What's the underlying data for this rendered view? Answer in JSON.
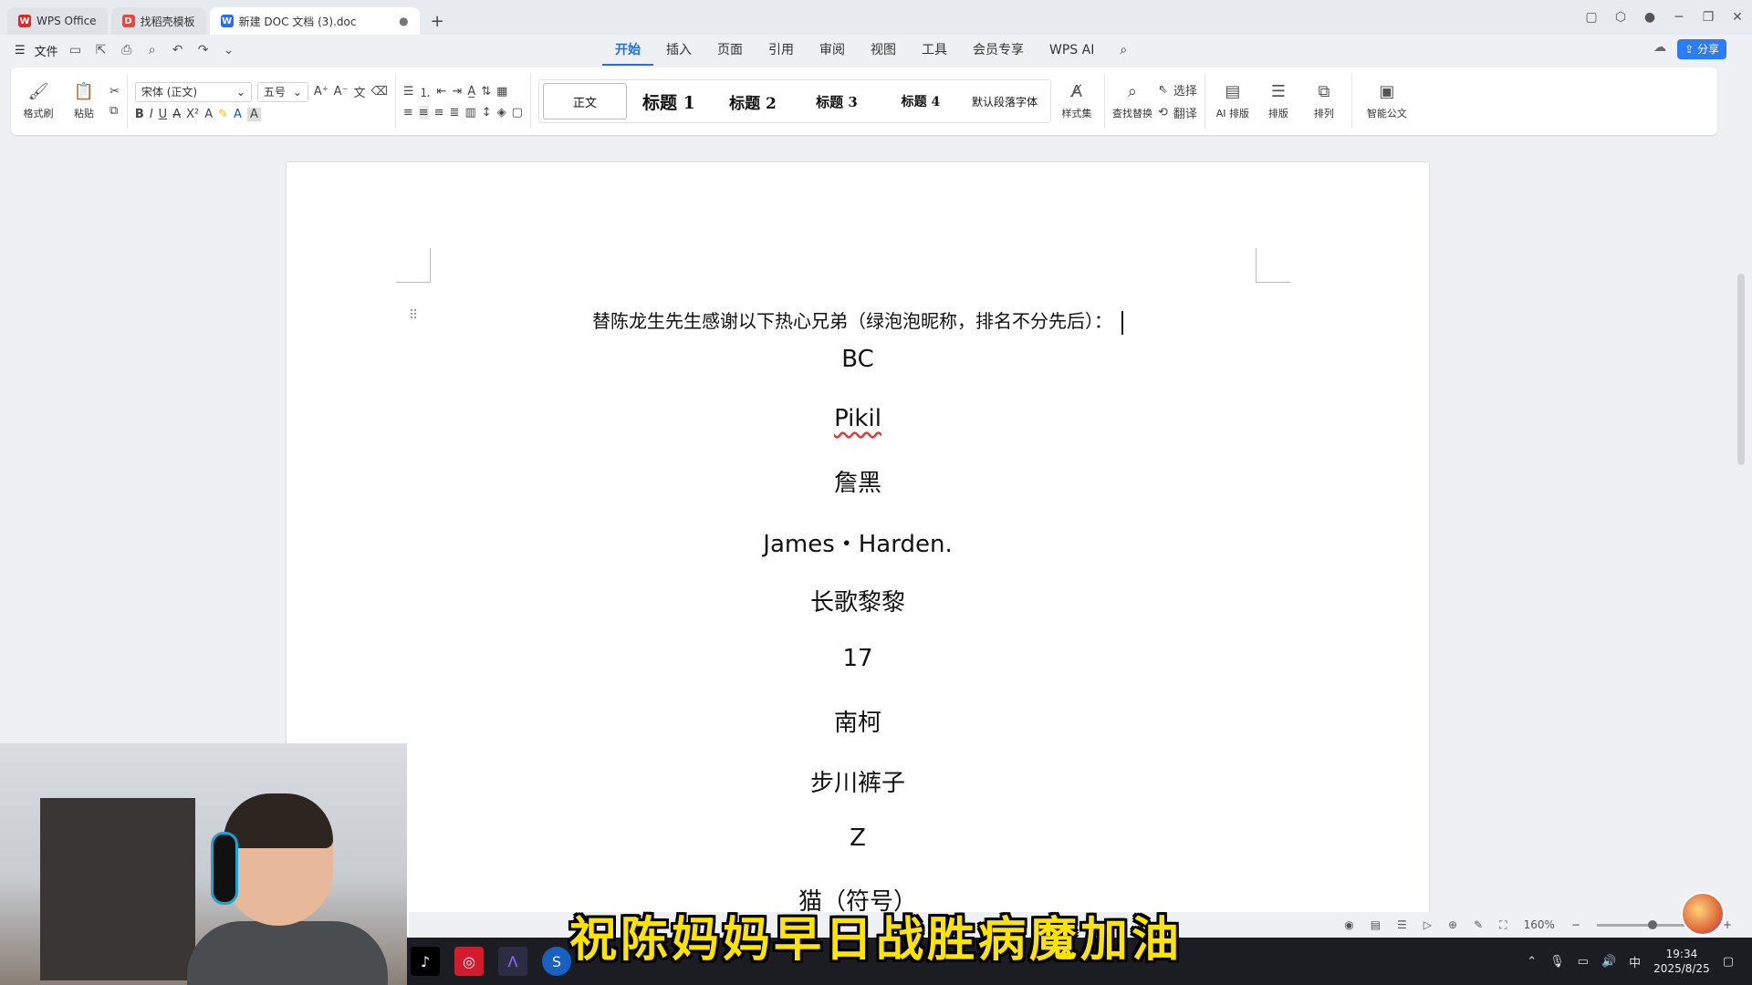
{
  "tabs": [
    {
      "label": "WPS Office",
      "color": "#d9292b",
      "glyph": "W"
    },
    {
      "label": "找稻壳模板",
      "color": "#e34a3d",
      "glyph": "D"
    },
    {
      "label": "新建 DOC 文档 (3).doc",
      "color": "#2b6de8",
      "glyph": "W"
    }
  ],
  "menubar": {
    "file": "文件",
    "items": [
      "开始",
      "插入",
      "页面",
      "引用",
      "审阅",
      "视图",
      "工具",
      "会员专享",
      "WPS AI"
    ],
    "selected": "开始",
    "share": "分享"
  },
  "ribbon": {
    "format_painter": "格式刷",
    "paste": "粘贴",
    "font_name": "宋体 (正文)",
    "font_size": "五号",
    "styles": [
      "正文",
      "标题 1",
      "标题 2",
      "标题 3",
      "标题 4",
      "默认段落字体"
    ],
    "style_set": "样式集",
    "find_replace": "查找替换",
    "select": "选择",
    "translate": "翻译",
    "ai_layout": "AI 排版",
    "layout": "排版",
    "arrange": "排列",
    "smart_doc": "智能公文"
  },
  "document": {
    "intro": "替陈龙生先生感谢以下热心兄弟（绿泡泡昵称，排名不分先后）：",
    "names": [
      "BC",
      "Pikil",
      "詹黑",
      "James・Harden.",
      "长歌黎黎",
      "17",
      "南柯",
      "步川裤子",
      "Z",
      "猫（符号）"
    ]
  },
  "statusbar": {
    "zoom": "160%"
  },
  "tray": {
    "ime": "中",
    "time": "19:34",
    "date": "2025/8/25"
  },
  "subtitle": "祝陈妈妈早日战胜病魔加油"
}
